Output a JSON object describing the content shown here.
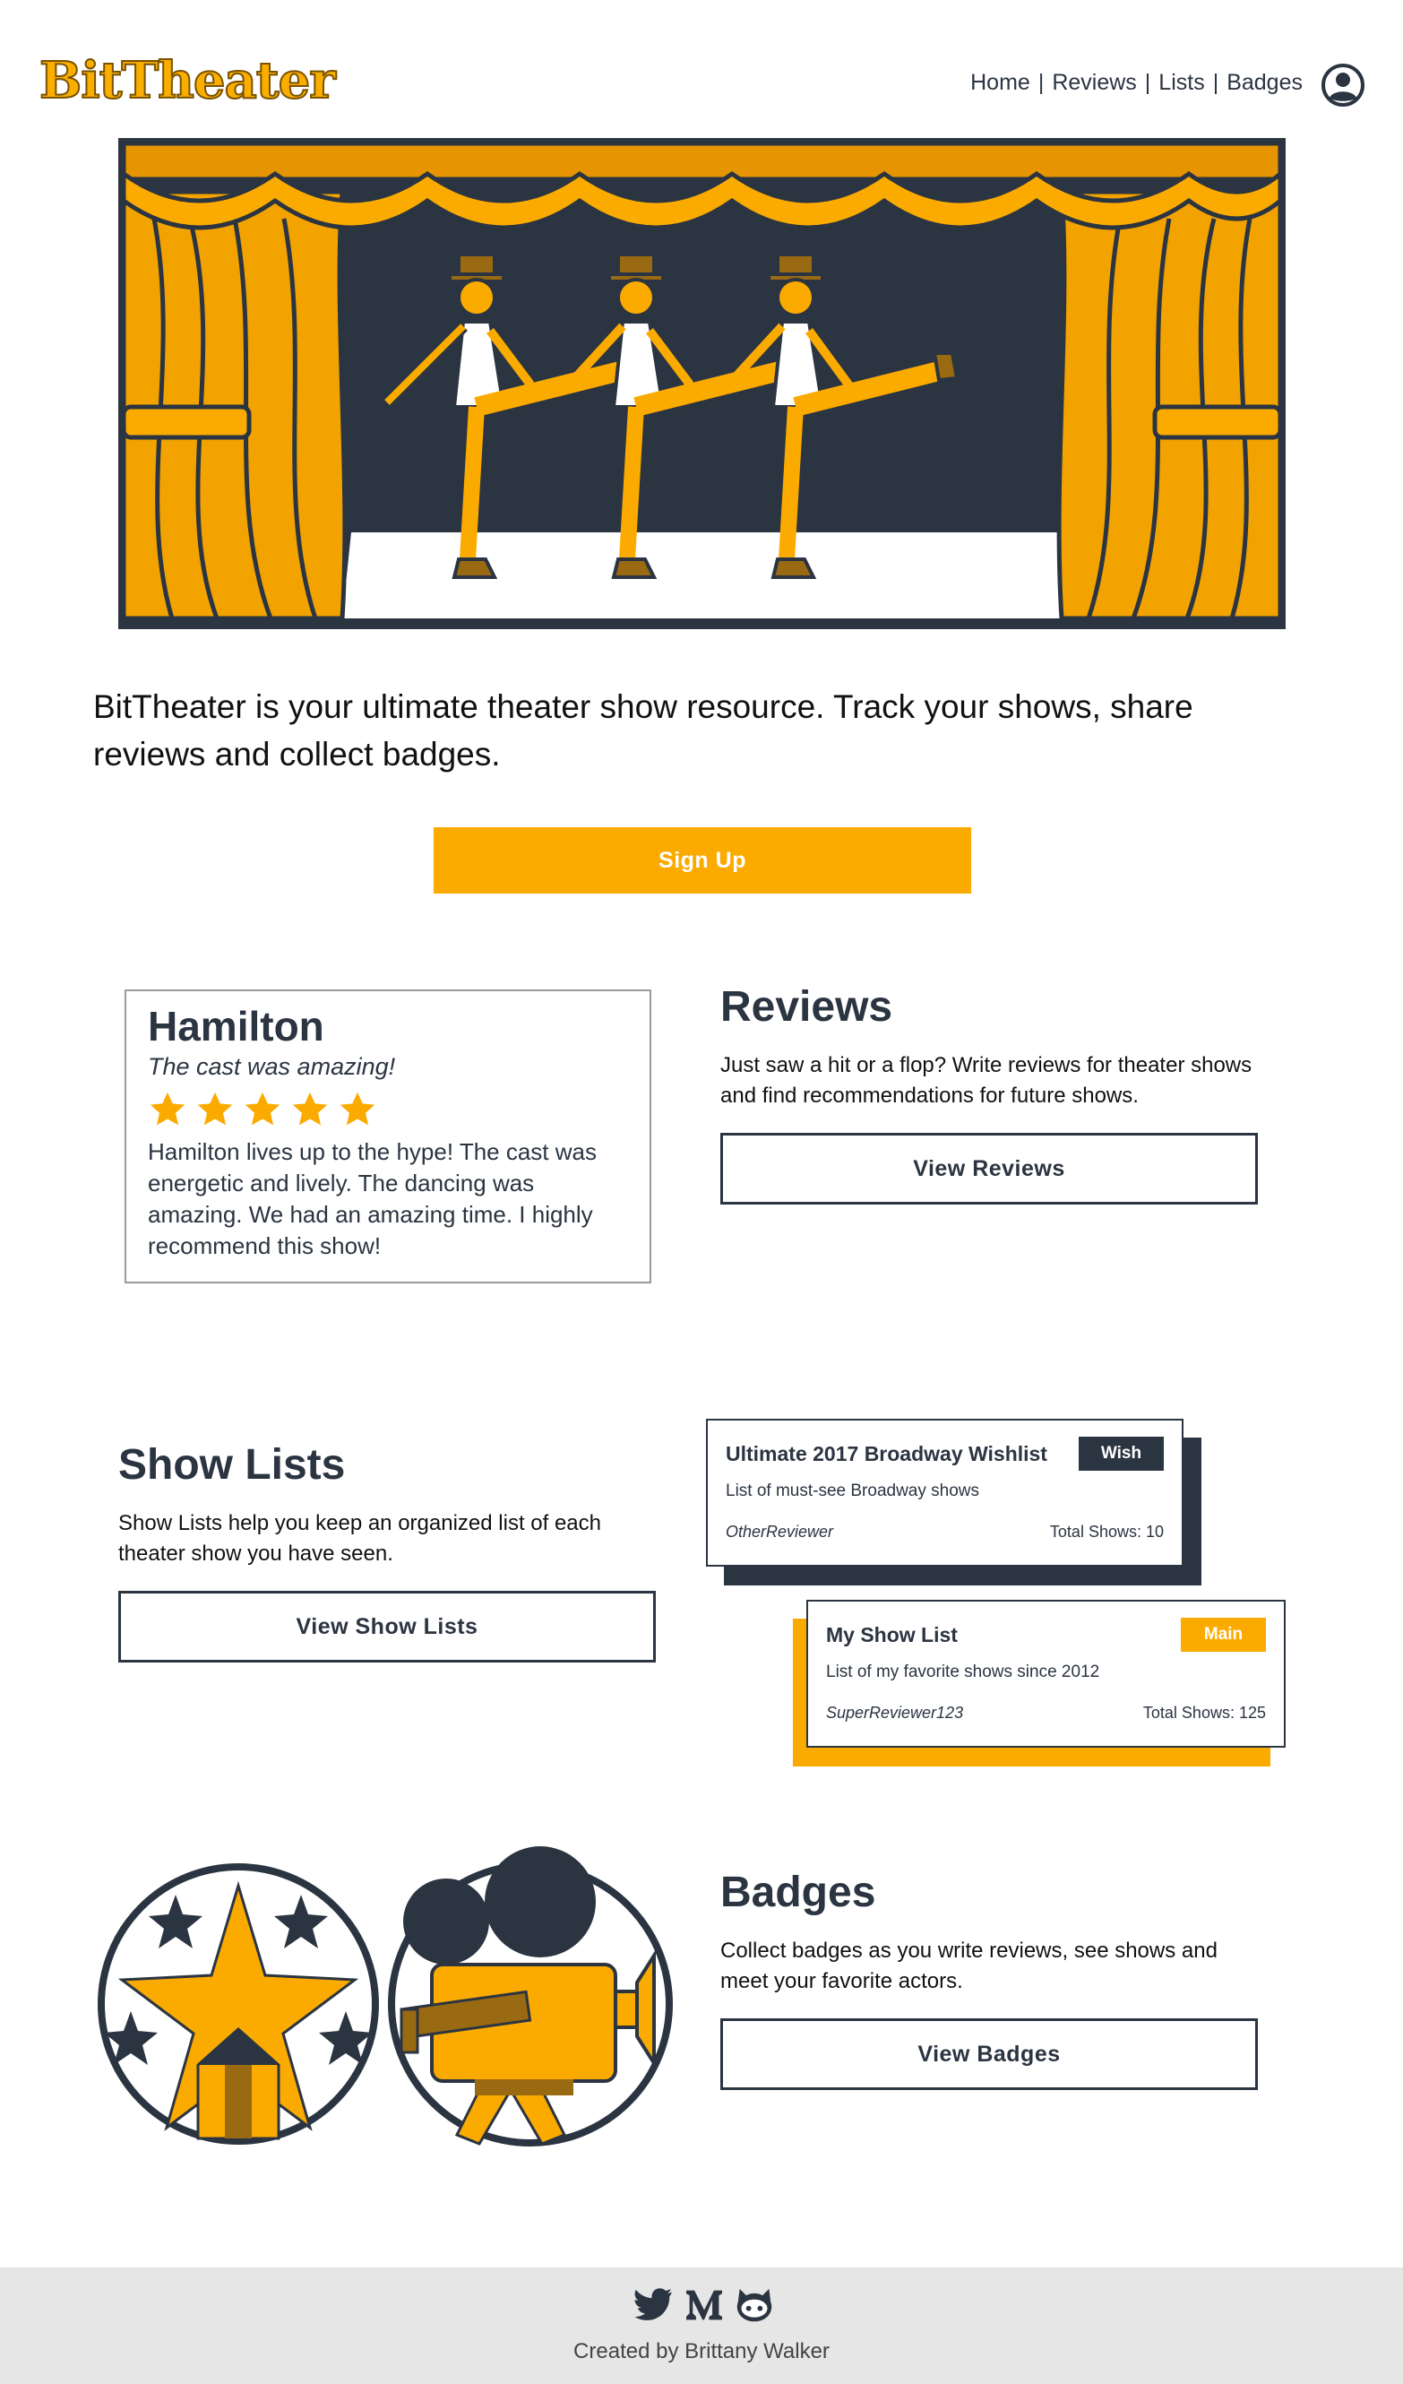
{
  "header": {
    "logo": "BitTheater",
    "nav": [
      {
        "label": "Home"
      },
      {
        "label": "Reviews"
      },
      {
        "label": "Lists"
      },
      {
        "label": "Badges"
      }
    ],
    "nav_separator": "|",
    "profile_icon": "user-circle-icon"
  },
  "intro": {
    "text": "BitTheater is your ultimate theater show resource. Track your shows, share reviews and collect badges."
  },
  "signup": {
    "label": "Sign Up"
  },
  "review_card": {
    "title": "Hamilton",
    "tagline": "The cast was amazing!",
    "rating": 5,
    "body": "Hamilton lives up to the hype! The cast was energetic and lively. The dancing was amazing. We had an amazing time. I highly recommend this show!"
  },
  "reviews": {
    "title": "Reviews",
    "text": "Just saw a hit or a flop? Write reviews for theater shows and find recommendations for future shows.",
    "button": "View Reviews"
  },
  "show_lists": {
    "title": "Show Lists",
    "text": "Show Lists help you keep an organized list of each theater show you have seen.",
    "button": "View Show Lists",
    "cards": [
      {
        "title": "Ultimate 2017 Broadway Wishlist",
        "badge": "Wish",
        "badge_color": "#2B3441",
        "description": "List of must-see Broadway shows",
        "user": "OtherReviewer",
        "total": "Total Shows: 10"
      },
      {
        "title": "My Show List",
        "badge": "Main",
        "badge_color": "#FBAB00",
        "description": "List of my favorite shows since 2012",
        "user": "SuperReviewer123",
        "total": "Total Shows: 125"
      }
    ]
  },
  "badges": {
    "title": "Badges",
    "text": "Collect badges as you write reviews, see shows and meet your favorite actors.",
    "button": "View Badges"
  },
  "footer": {
    "icons": [
      "twitter-icon",
      "medium-icon",
      "github-icon"
    ],
    "credit": "Created by Brittany Walker"
  },
  "colors": {
    "accent": "#FBAB00",
    "dark": "#2B3441",
    "footer_bg": "#E6E6E6"
  }
}
